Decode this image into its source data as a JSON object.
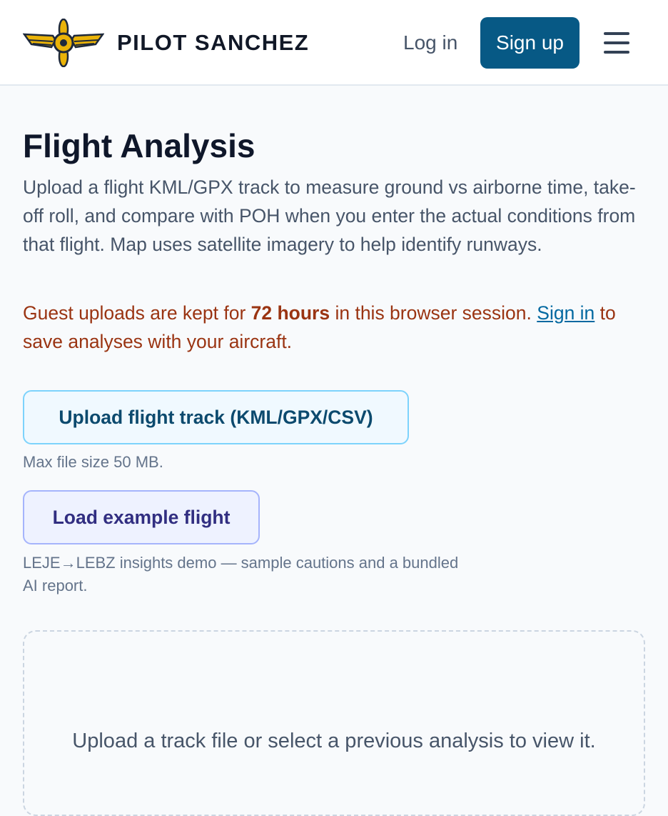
{
  "header": {
    "brand": "PILOT SANCHEZ",
    "login_label": "Log in",
    "signup_label": "Sign up",
    "logo_icon": "winged-propeller-icon",
    "menu_icon": "hamburger-menu-icon"
  },
  "page": {
    "title": "Flight Analysis",
    "description": "Upload a flight KML/GPX track to measure ground vs airborne time, take-off roll, and compare with POH when you enter the actual conditions from that flight. Map uses satellite imagery to help identify runways.",
    "guest_notice": {
      "prefix": "Guest uploads are kept for ",
      "duration": "72 hours",
      "middle": " in this browser session. ",
      "link": "Sign in",
      "suffix": " to save analyses with your aircraft."
    }
  },
  "actions": {
    "upload_label": "Upload flight track (KML/GPX/CSV)",
    "upload_hint": "Max file size 50 MB.",
    "example_label": "Load example flight",
    "example_hint": "LEJE→LEBZ insights demo — sample cautions and a bundled AI report."
  },
  "dropzone": {
    "message": "Upload a track file or select a previous analysis to view it."
  },
  "colors": {
    "primary": "#075985",
    "notice": "#9a3412",
    "link": "#0369a1",
    "logo_gold": "#eab308",
    "logo_dark": "#1e293b"
  }
}
